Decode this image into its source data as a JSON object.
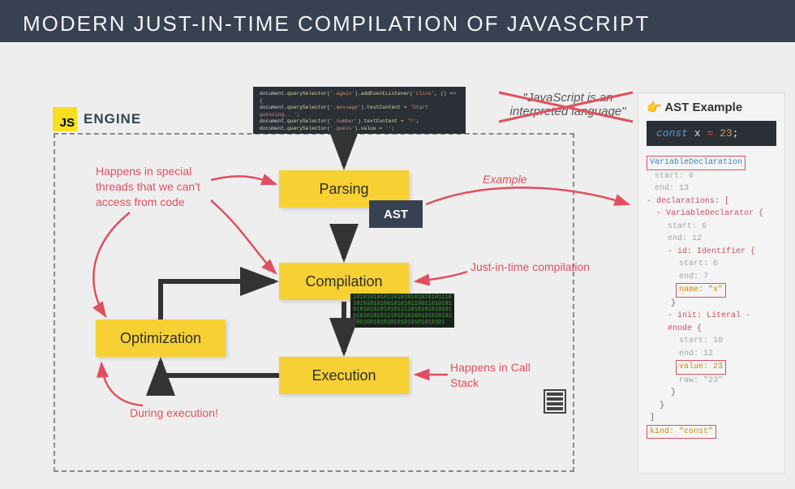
{
  "header": {
    "title": "MODERN JUST-IN-TIME COMPILATION OF JAVASCRIPT"
  },
  "engine": {
    "badge": "JS",
    "label": "ENGINE"
  },
  "source_code": {
    "line1_a": "document",
    "line1_b": ".querySelector(",
    "line1_c": "'.again'",
    "line1_d": ").addEventListener(",
    "line1_e": "'click'",
    "line1_f": ", () => {",
    "line2_a": "  document",
    "line2_b": ".querySelector(",
    "line2_c": "'.message'",
    "line2_d": ").textContent = ",
    "line2_e": "'Start guessing...'",
    "line2_f": ";",
    "line3_a": "  document",
    "line3_b": ".querySelector(",
    "line3_c": "'.number'",
    "line3_d": ").textContent = ",
    "line3_e": "'?'",
    "line3_f": ";",
    "line4_a": "  document",
    "line4_b": ".querySelector(",
    "line4_c": "'.guess'",
    "line4_d": ").value = ",
    "line4_e": "''",
    "line4_f": ";"
  },
  "stages": {
    "parsing": "Parsing",
    "compilation": "Compilation",
    "execution": "Execution",
    "optimization": "Optimization",
    "ast": "AST"
  },
  "binary": "10101010101101010101010101110101010101001010101100110101010101010101010111101010101010101010101011101010100101010101100100101010101010101010101",
  "annotations": {
    "threads": "Happens in special threads that we can't access from code",
    "jit": "Just-in-time compilation",
    "callstack": "Happens in Call Stack",
    "during": "During execution!",
    "example_arrow": "Example",
    "struck": "\"JavaScript is an interpreted language\""
  },
  "ast_panel": {
    "pointer": "👉",
    "title": "AST Example",
    "code": {
      "kw": "const",
      "id": "x",
      "op": "=",
      "num": "23",
      "semi": ";"
    },
    "tree": {
      "n0": "VariableDeclaration",
      "n1": "start: 0",
      "n2": "end: 13",
      "n3": "- declarations:  [",
      "n4": "- VariableDeclarator  {",
      "n5": "start: 6",
      "n6": "end: 12",
      "n7": "- id: Identifier  {",
      "n8": "start: 6",
      "n9": "end: 7",
      "n10": "name: \"x\"",
      "n11": "}",
      "n12": "- init: Literal - #node {",
      "n13": "start: 10",
      "n14": "end: 12",
      "n15": "value: 23",
      "n16": "raw: \"23\"",
      "n17": "}",
      "n18": "}",
      "n19": "]",
      "n20": "kind: \"const\""
    }
  }
}
